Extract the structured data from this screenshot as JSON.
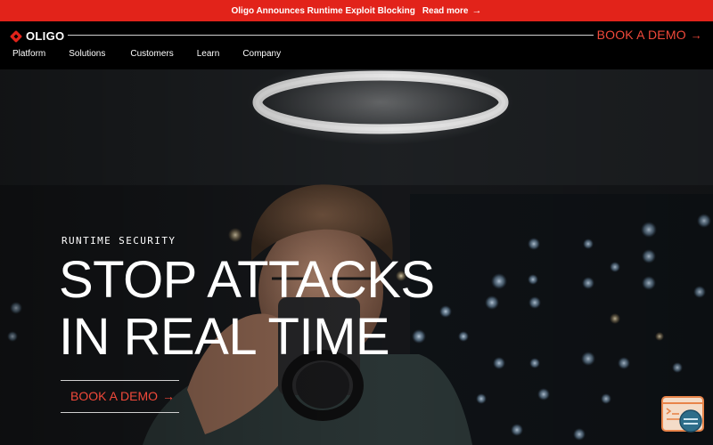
{
  "announcement": {
    "text": "Oligo Announces Runtime Exploit Blocking",
    "link_label": "Read more",
    "arrow": "→"
  },
  "header": {
    "logo_text": "OLIGO",
    "cta_label": "BOOK A DEMO",
    "cta_arrow": "→"
  },
  "nav": {
    "items": [
      "Platform",
      "Solutions",
      "Customers",
      "Learn",
      "Company"
    ]
  },
  "hero": {
    "eyebrow": "RUNTIME SECURITY",
    "headline_line1": "STOP ATTACKS",
    "headline_line2": "IN REAL TIME",
    "cta_label": "BOOK A DEMO",
    "cta_arrow": "→"
  },
  "colors": {
    "brand_red": "#e2231a",
    "accent_red": "#f0493a",
    "chat_orange": "#e8844a"
  },
  "icons": {
    "logo": "oligo-diamond-icon",
    "chat": "chat-widget-icon"
  }
}
